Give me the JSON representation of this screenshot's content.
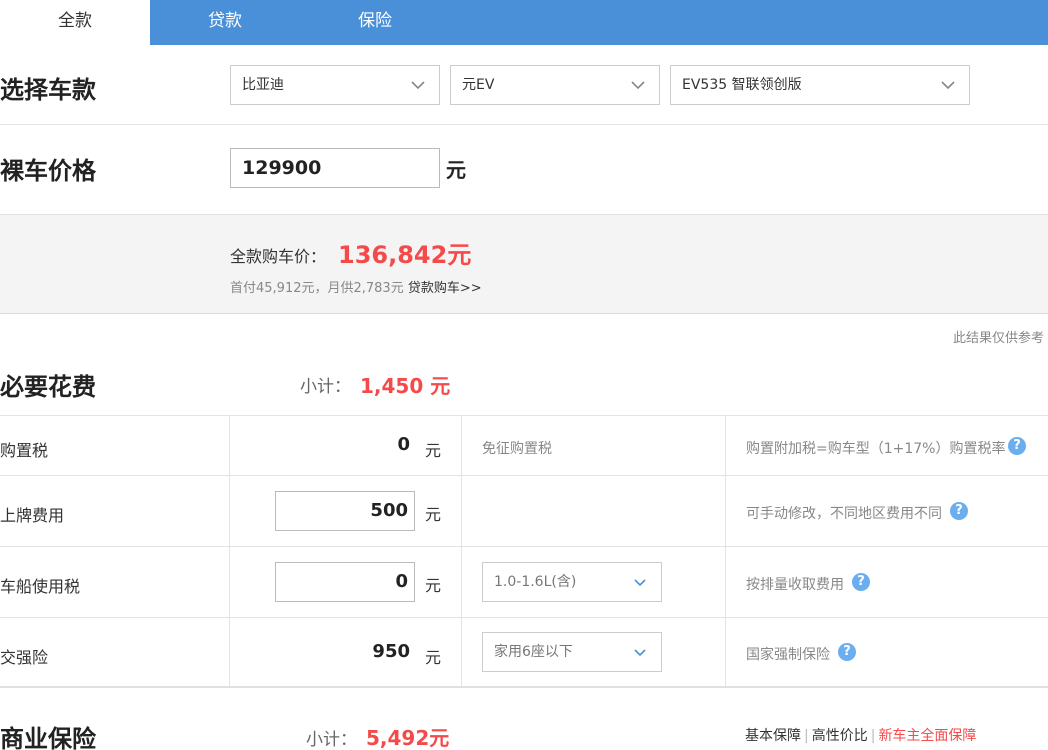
{
  "tabs": [
    {
      "label": "全款"
    },
    {
      "label": "贷款"
    },
    {
      "label": "保险"
    }
  ],
  "select_car": {
    "title": "选择车款",
    "brand": "比亚迪",
    "series": "元EV",
    "model": "EV535 智联领创版"
  },
  "bare_price": {
    "title": "裸车价格",
    "value": "129900",
    "unit": "元"
  },
  "summary": {
    "label": "全款购车价：",
    "value": "136,842元",
    "sub_text": "首付45,912元，月供2,783元",
    "loan_link": "贷款购车>>",
    "note": "此结果仅供参考"
  },
  "necessary": {
    "title": "必要花费",
    "subtotal_label": "小计：",
    "subtotal_value": "1,450 元",
    "rows": [
      {
        "label": "购置税",
        "value": "0",
        "unit": "元",
        "middle": "免征购置税",
        "desc": "购置附加税=购车型（1+17%）购置税率"
      },
      {
        "label": "上牌费用",
        "value": "500",
        "unit": "元",
        "middle": "",
        "desc": "可手动修改，不同地区费用不同"
      },
      {
        "label": "车船使用税",
        "value": "0",
        "unit": "元",
        "middle": "1.0-1.6L(含)",
        "desc": "按排量收取费用"
      },
      {
        "label": "交强险",
        "value": "950",
        "unit": "元",
        "middle": "家用6座以下",
        "desc": "国家强制保险"
      }
    ]
  },
  "commercial": {
    "title": "商业保险",
    "subtotal_label": "小计：",
    "subtotal_value": "5,492元",
    "links": [
      "基本保障",
      "高性价比",
      "新车主全面保障"
    ],
    "link_sep": "|"
  },
  "icons": {
    "dropdown": "chevron-down-icon",
    "help": "help-icon"
  },
  "colors": {
    "tab_bar": "#4a90d9",
    "accent_red": "#f44a4a",
    "help_blue": "#6aaeef"
  },
  "help_glyph": "?"
}
